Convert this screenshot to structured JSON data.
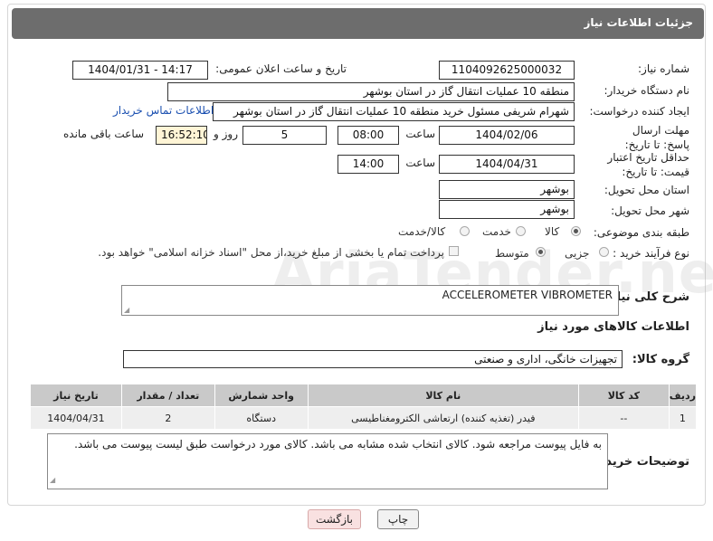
{
  "header": {
    "title": "جزئیات اطلاعات نیاز"
  },
  "fields": {
    "need_number_label": "شماره نیاز:",
    "need_number": "1104092625000032",
    "announce_label": "تاریخ و ساعت اعلان عمومی:",
    "announce_value": "1404/01/31 - 14:17",
    "buyer_org_label": "نام دستگاه خریدار:",
    "buyer_org": "منطقه 10 عملیات انتقال گاز در استان بوشهر",
    "requester_label": "ایجاد کننده درخواست:",
    "requester": "شهرام شریفی مسئول خرید منطقه 10 عملیات انتقال گاز در استان بوشهر",
    "contact_link": "اطلاعات تماس خریدار",
    "deadline_label": "مهلت ارسال پاسخ: تا تاریخ:",
    "deadline_date": "1404/02/06",
    "hour_label": "ساعت",
    "deadline_time": "08:00",
    "days_value": "5",
    "days_label": "روز و",
    "remaining_time": "16:52:10",
    "remaining_label": "ساعت باقی مانده",
    "validity_label": "حداقل تاریخ اعتبار قیمت: تا تاریخ:",
    "validity_date": "1404/04/31",
    "validity_time": "14:00",
    "province_label": "استان محل تحویل:",
    "province": "بوشهر",
    "city_label": "شهر محل تحویل:",
    "city": "بوشهر",
    "category_label": "طبقه بندی موضوعی:",
    "category_options": [
      "کالا",
      "خدمت",
      "کالا/خدمت"
    ],
    "purchase_type_label": "نوع فرآیند خرید :",
    "purchase_options": [
      "جزیی",
      "متوسط"
    ],
    "payment_note": "پرداخت تمام یا بخشی از مبلغ خرید،از محل \"اسناد خزانه اسلامی\" خواهد بود."
  },
  "general_desc_label": "شرح کلی نیاز:",
  "general_desc": "ACCELEROMETER VIBROMETER",
  "items_section_title": "اطلاعات کالاهای مورد نیاز",
  "goods_group_label": "گروه کالا:",
  "goods_group": "تجهیزات خانگی، اداری و صنعتی",
  "table": {
    "headers": [
      "ردیف",
      "کد کالا",
      "نام کالا",
      "واحد شمارش",
      "تعداد / مقدار",
      "تاریخ نیاز"
    ],
    "rows": [
      [
        "1",
        "--",
        "فیدر (تغذیه کننده) ارتعاشی الکترومغناطیسی",
        "دستگاه",
        "2",
        "1404/04/31"
      ]
    ]
  },
  "buyer_notes_label": "توضیحات خریدار:",
  "buyer_notes": "به فایل پیوست مراجعه شود. کالای انتخاب شده مشابه می باشد. کالای مورد درخواست طبق لیست پیوست می باشد.",
  "buttons": {
    "print": "چاپ",
    "back": "بازگشت"
  },
  "watermark": "AriaTender.neT"
}
